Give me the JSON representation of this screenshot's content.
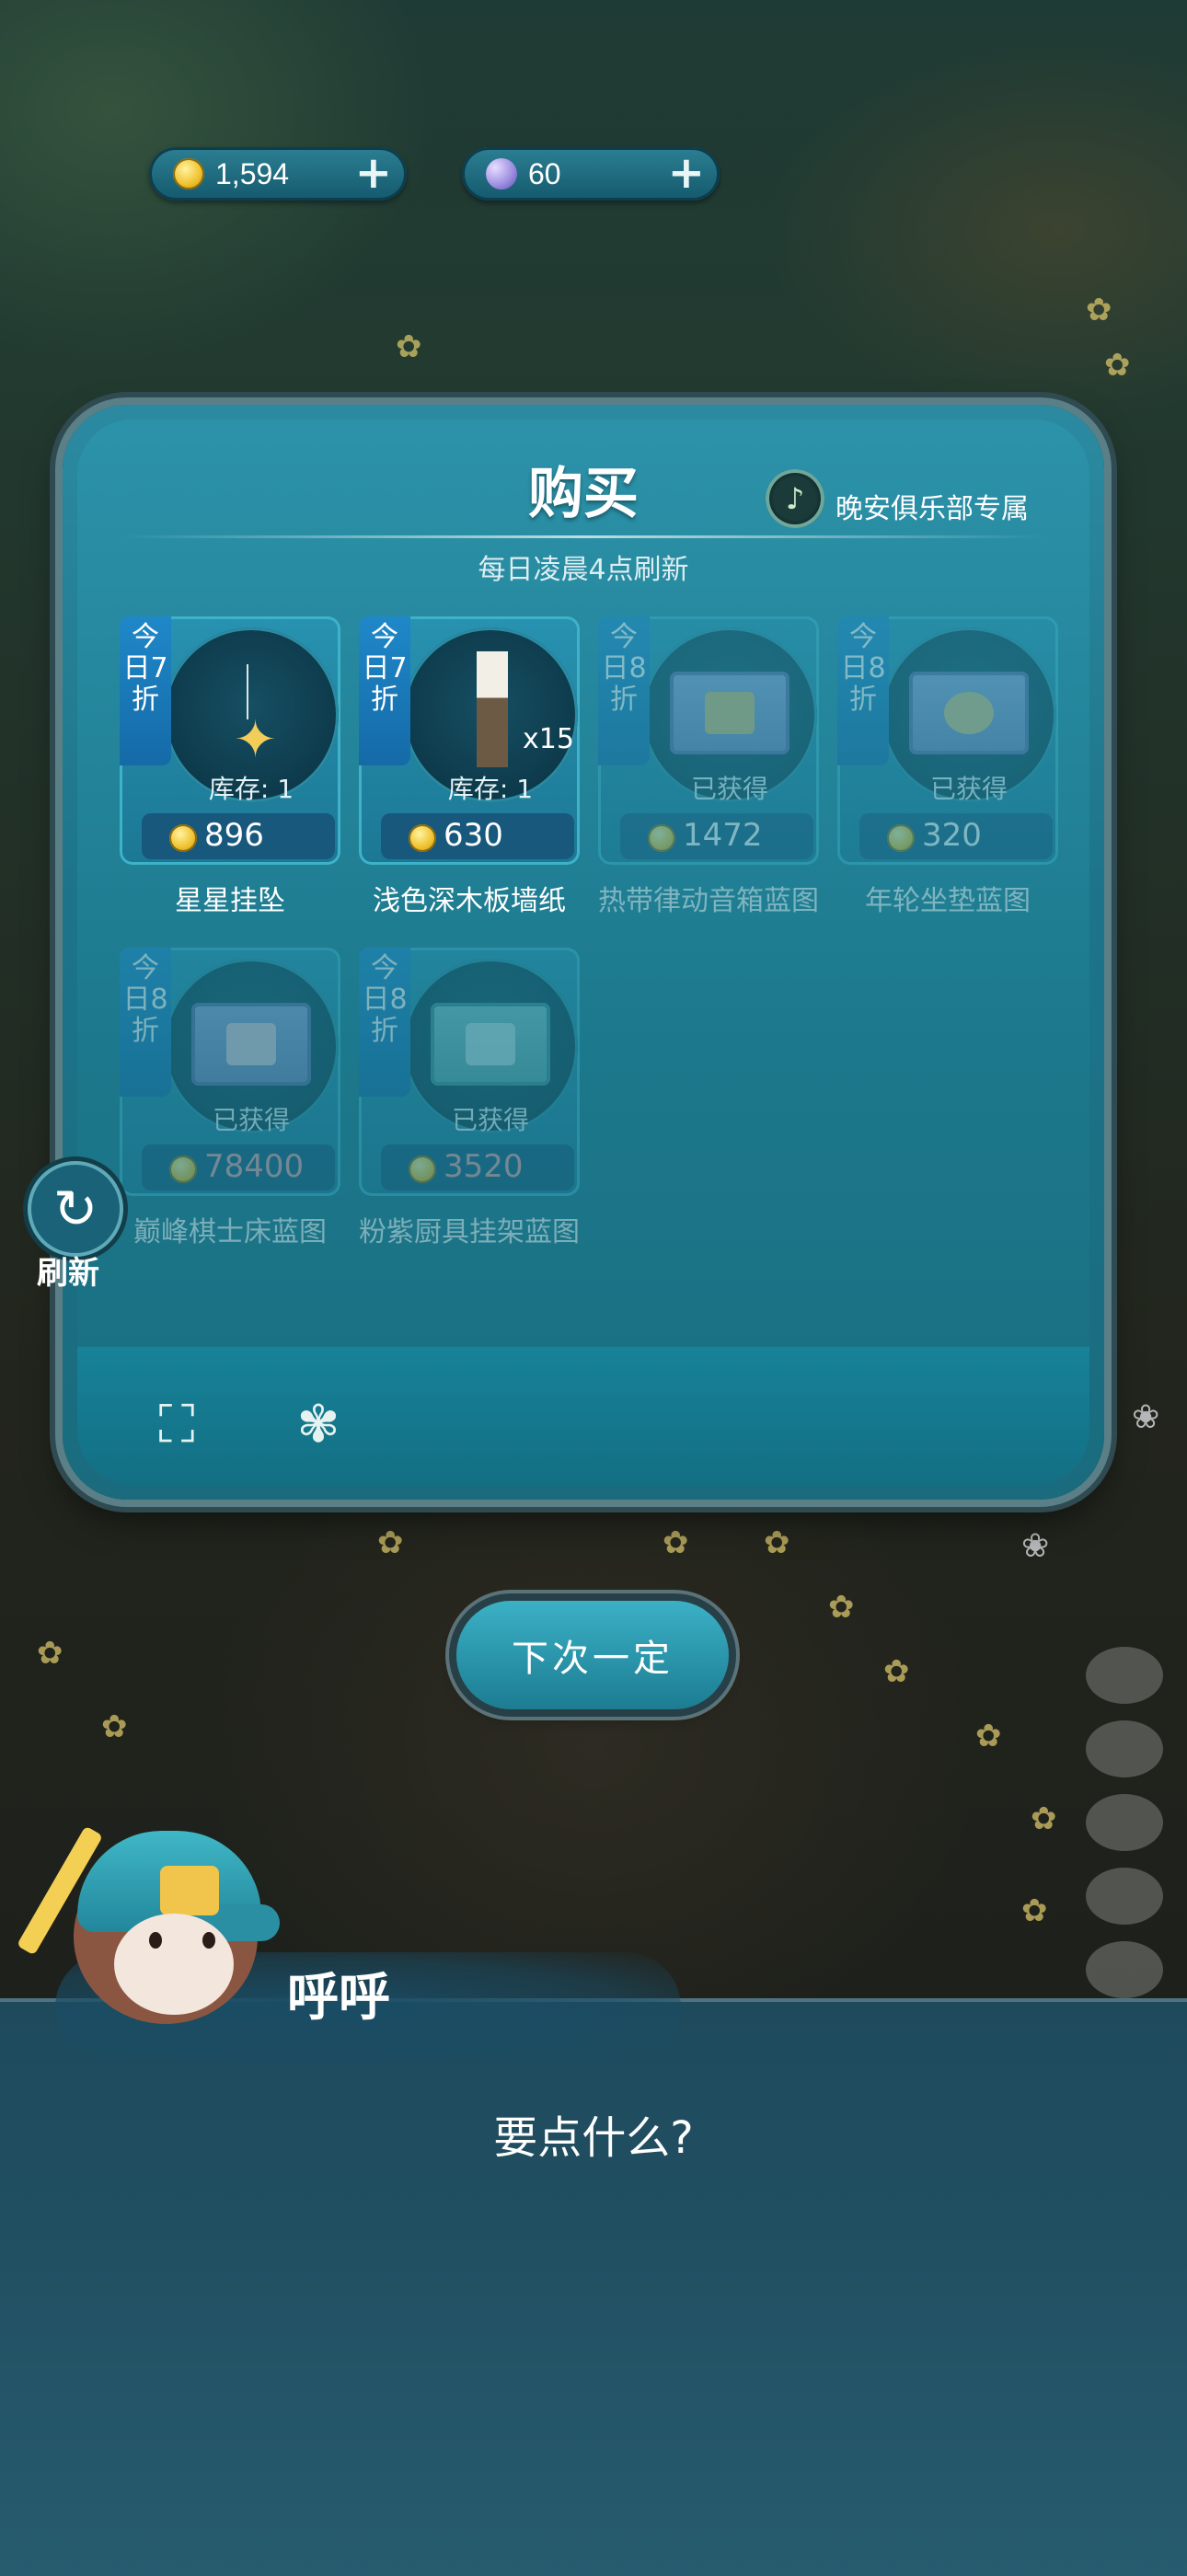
{
  "currency": {
    "coins": "1,594",
    "moons": "60",
    "add_icon": "plus-icon"
  },
  "shop": {
    "title": "购买",
    "club_label": "晚安俱乐部专属",
    "refresh_note": "每日凌晨4点刷新",
    "items": [
      {
        "name": "星星挂坠",
        "discount": "今日7折",
        "stock": "库存: 1",
        "price": "896",
        "owned": false
      },
      {
        "name": "浅色深木板墙纸",
        "discount": "今日7折",
        "stock": "库存: 1",
        "price": "630",
        "qty": "x15",
        "owned": false
      },
      {
        "name": "热带律动音箱蓝图",
        "discount": "今日8折",
        "stock": "已获得",
        "price": "1472",
        "owned": true
      },
      {
        "name": "年轮坐垫蓝图",
        "discount": "今日8折",
        "stock": "已获得",
        "price": "320",
        "owned": true
      },
      {
        "name": "巅峰棋士床蓝图",
        "discount": "今日8折",
        "stock": "已获得",
        "price": "78400",
        "owned": true
      },
      {
        "name": "粉紫厨具挂架蓝图",
        "discount": "今日8折",
        "stock": "已获得",
        "price": "3520",
        "owned": true
      }
    ]
  },
  "refresh_label": "刷新",
  "footer_icons": [
    "blueprint-map-icon",
    "pin-flower-icon"
  ],
  "next_button": "下次一定",
  "dialog": {
    "speaker": "呼呼",
    "text": "要点什么?"
  },
  "colors": {
    "panel": "#1d7489",
    "tag": "#1f88c9",
    "price_bar": "#17587c"
  }
}
